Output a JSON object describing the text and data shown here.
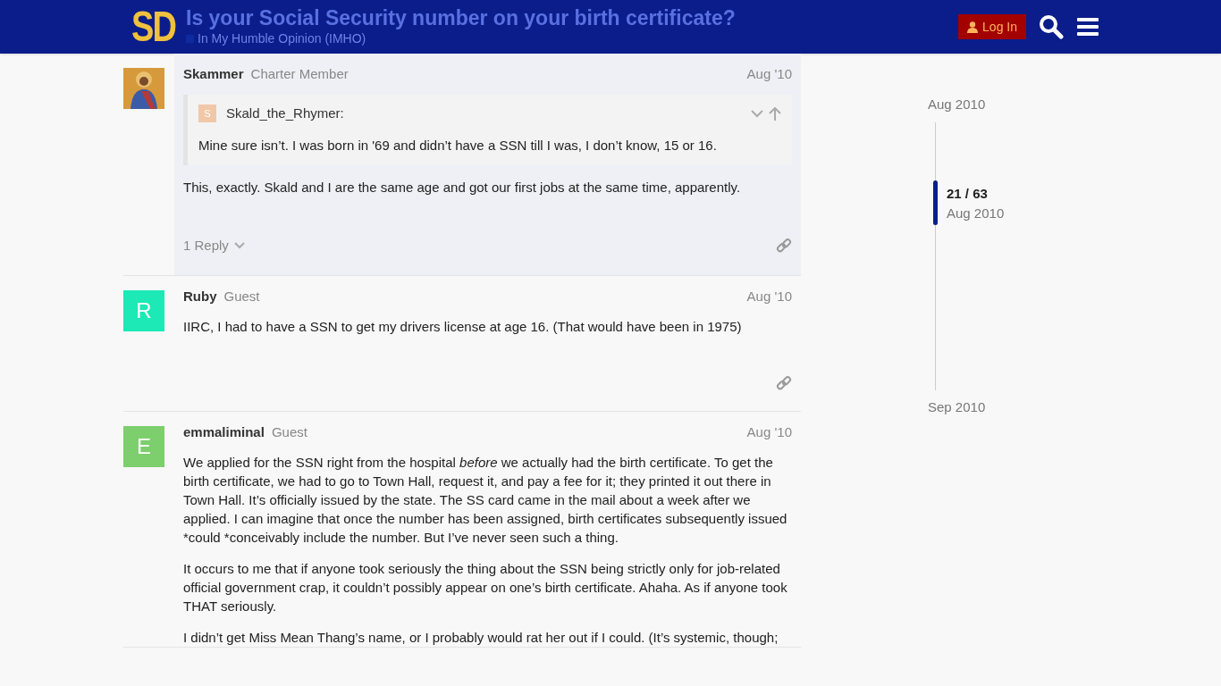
{
  "header": {
    "logo": "SD",
    "title": "Is your Social Security number on your birth certificate?",
    "category": {
      "name": "In My Humble Opinion (IMHO)",
      "color": "#0e2a9e"
    },
    "login_label": "Log In"
  },
  "posts": [
    {
      "avatar": {
        "kind": "picture"
      },
      "username": "Skammer",
      "title": "Charter Member",
      "date": "Aug '10",
      "highlighted": true,
      "quote": {
        "avatar_letter": "S",
        "author": "Skald_the_Rhymer:",
        "text": "Mine sure isn’t. I was born in '69 and didn’t have a SSN till I was, I don’t know, 15 or 16."
      },
      "paragraphs": [
        "This, exactly. Skald and I are the same age and got our first jobs at the same time, apparently."
      ],
      "replies": "1 Reply"
    },
    {
      "avatar": {
        "kind": "letter",
        "letter": "R",
        "color": "#1de9b6"
      },
      "username": "Ruby",
      "title": "Guest",
      "date": "Aug '10",
      "highlighted": false,
      "paragraphs": [
        "IIRC, I had to have a SSN to get my drivers license at age 16. (That would have been in 1975)"
      ]
    },
    {
      "avatar": {
        "kind": "letter",
        "letter": "E",
        "color": "#7ccf6c"
      },
      "username": "emmaliminal",
      "title": "Guest",
      "date": "Aug '10",
      "highlighted": false,
      "paragraphs": [
        "We applied for the SSN right from the hospital *before* we actually had the birth certificate. To get the birth certificate, we had to go to Town Hall, request it, and pay a fee for it; they printed it out there in Town Hall. It’s officially issued by the state. The SS card came in the mail about a week after we applied. I can imagine that once the number has been assigned, birth certificates subsequently issued *could *conceivably include the number. But I’ve never seen such a thing.",
        "It occurs to me that if anyone took seriously the thing about the SSN being strictly only for job-related official government crap, it couldn’t possibly appear on one’s birth certificate. Ahaha. As if anyone took THAT seriously.",
        "I didn’t get Miss Mean Thang’s name, or I probably would rat her out if I could. (It’s systemic, though;"
      ]
    }
  ],
  "timeline": {
    "start": "Aug 2010",
    "position": "21 / 63",
    "position_date": "Aug 2010",
    "end": "Sep 2010",
    "level": 0.26
  }
}
